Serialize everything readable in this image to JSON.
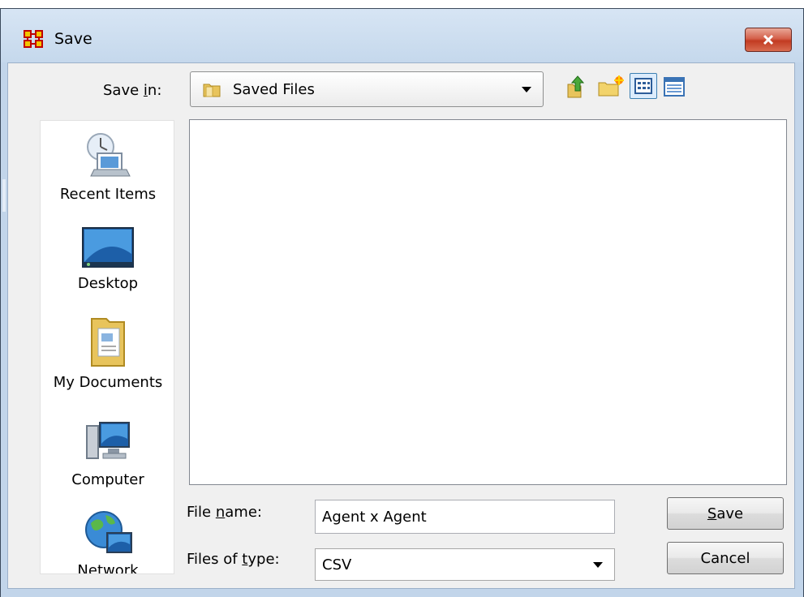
{
  "window": {
    "title": "Save",
    "close_label": "Close"
  },
  "save_in": {
    "label_prefix": "Save ",
    "label_mnemonic": "i",
    "label_suffix": "n:",
    "value": "Saved Files"
  },
  "toolbar": {
    "up_icon": "up-one-level-icon",
    "new_folder_icon": "new-folder-icon",
    "list_view_icon": "list-view-icon",
    "details_view_icon": "details-view-icon"
  },
  "places": [
    {
      "label": "Recent Items",
      "icon": "recent-items-icon"
    },
    {
      "label": "Desktop",
      "icon": "desktop-icon"
    },
    {
      "label": "My Documents",
      "icon": "my-documents-icon"
    },
    {
      "label": "Computer",
      "icon": "computer-icon"
    },
    {
      "label": "Network",
      "icon": "network-icon"
    }
  ],
  "file_name": {
    "label_prefix": "File ",
    "label_mnemonic": "n",
    "label_suffix": "ame:",
    "value": "Agent x Agent"
  },
  "file_type": {
    "label_prefix": "Files of ",
    "label_mnemonic": "t",
    "label_suffix": "ype:",
    "value": "CSV"
  },
  "buttons": {
    "save_mnemonic": "S",
    "save_rest": "ave",
    "cancel": "Cancel"
  },
  "colors": {
    "frame": "#c2d5ea",
    "close_button": "#c23b22",
    "client": "#f0f0f0"
  }
}
